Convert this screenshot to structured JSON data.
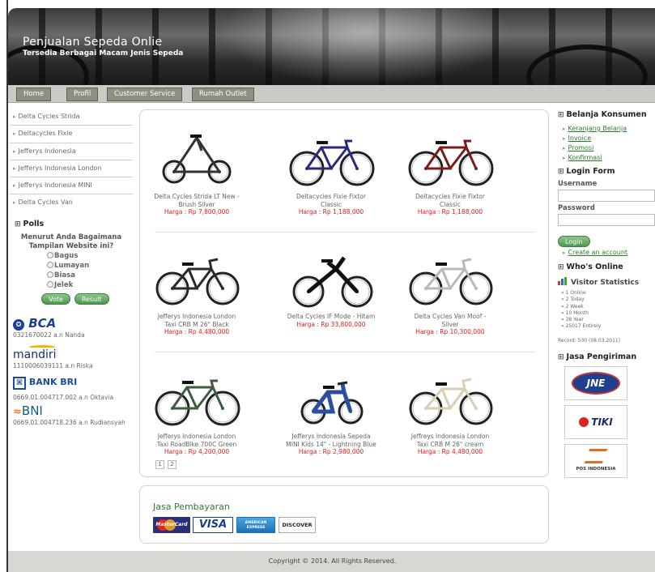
{
  "header": {
    "title": "Penjualan Sepeda Onlie",
    "subtitle": "Tersedia Berbagai Macam Jenis Sepeda"
  },
  "nav": {
    "tabs": [
      "Home",
      "Profil",
      "Customer Service",
      "Rumah Outlet"
    ]
  },
  "left_sidebar": {
    "categories": [
      "Delta Cycles Strida",
      "Deltacycles Fixie",
      "Jefferys Indonesia",
      "Jefferys Indonesia London",
      "Jefferys Indonesia MINI",
      "Delta Cycles Van"
    ],
    "polls": {
      "heading": "Polls",
      "question": "Menurut Anda Bagaimana Tampilan Website ini?",
      "options": [
        "Bagus",
        "Lumayan",
        "Biasa",
        "Jelek"
      ],
      "vote_label": "Vote",
      "result_label": "Result"
    },
    "banks": [
      {
        "name": "BCA",
        "account": "0321670022 a.n Nanda"
      },
      {
        "name": "mandiri",
        "account": "1110006039111 a.n Riska"
      },
      {
        "name": "BANK BRI",
        "account": "0669.01.004717.002 a.n Oktavia"
      },
      {
        "name": "BNI",
        "account": "0669.01.004718.236 a.n Rudiansyah"
      }
    ]
  },
  "products": [
    {
      "name": "Delta Cycles Strida LT New - Brush Silver",
      "price": "Harga : Rp 7,800,000",
      "style": "strida",
      "frame_color": "#333333"
    },
    {
      "name": "Deltacycles Fixie Fixtor Classic",
      "price": "Harga : Rp 1,188,000",
      "style": "road",
      "frame_color": "#2a2a7a"
    },
    {
      "name": "Deltacycles Fixie Fixtor Classic",
      "price": "Harga : Rp 1,188,000",
      "style": "road",
      "frame_color": "#7a1c1c"
    },
    {
      "name": "Jefferys Indonesia London Taxi CRB M 26\" Black",
      "price": "Harga : Rp 4,480,000",
      "style": "city",
      "frame_color": "#2a2a2a"
    },
    {
      "name": "Delta Cycles IF Mode - Hitam",
      "price": "Harga : Rp 33,800,000",
      "style": "ifmode",
      "frame_color": "#111111"
    },
    {
      "name": "Delta Cycles Van Moof - Silver",
      "price": "Harga : Rp 10,300,000",
      "style": "city",
      "frame_color": "#b9b9b9"
    },
    {
      "name": "Jefferys Indonesia London Taxi RoadBike 700C Green",
      "price": "Harga : Rp 4,200,000",
      "style": "road",
      "frame_color": "#3e5e3e"
    },
    {
      "name": "Jefferys Indonesia Sepeda MINI Kids 14\" - Lightning Blue",
      "price": "Harga : Rp 2,980,000",
      "style": "kids",
      "frame_color": "#2a4fa0"
    },
    {
      "name": "Jeffreys Indonesia London Taxi CRB M 26\" cream",
      "price": "Harga : Rp 4,480,000",
      "style": "city",
      "frame_color": "#d8cfb4"
    }
  ],
  "pagination": [
    "1",
    "2"
  ],
  "payment": {
    "title": "Jasa Pembayaran",
    "cards": [
      "MasterCard",
      "VISA",
      "AMERICAN EXPRESS",
      "DISCOVER"
    ]
  },
  "right_sidebar": {
    "shopping_heading": "Belanja Konsumen",
    "shopping_links": [
      "Keranjang Belanja",
      "Invoice",
      "Promosi",
      "Konfirmasi"
    ],
    "login_heading": "Login Form",
    "username_label": "Username",
    "password_label": "Password",
    "login_button": "Login",
    "create_account": "Create an account",
    "online_heading": "Who's Online",
    "stats_title": "Visitor Statistics",
    "stats": [
      "1 Online",
      "2 Today",
      "2 Week",
      "10 Month",
      "38 Year",
      "25017 Entirely"
    ],
    "record": "Record: 530 (08.03.2011)",
    "shipping_heading": "Jasa Pengiriman",
    "shipping": [
      "JNE",
      "TIKI",
      "POS INDONESIA"
    ]
  },
  "footer": "Copyright © 2014. All Rights Reserved.",
  "colors": {
    "accent_green": "#2b7d2b",
    "price_red": "#e31b1b",
    "nav_tab": "#8a9180"
  }
}
